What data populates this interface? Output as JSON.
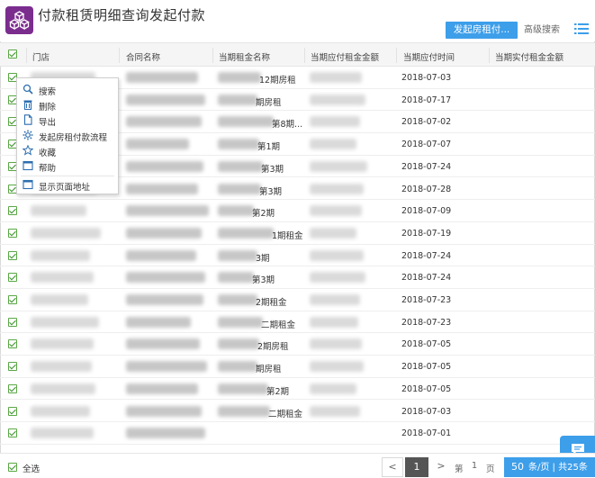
{
  "header": {
    "title": "付款租赁明细查询发起付款",
    "primary_button": "发起房租付...",
    "secondary_button": "高级搜索"
  },
  "table": {
    "columns": [
      "门店",
      "合同名称",
      "当期租金名称",
      "当期应付租金金额",
      "当期应付时间",
      "当期实付租金金额"
    ],
    "rows": [
      {
        "period": "12期房租",
        "date": "2018-07-03"
      },
      {
        "period": "期房租",
        "date": "2018-07-17"
      },
      {
        "period": "第8期...",
        "date": "2018-07-02"
      },
      {
        "period": "第1期",
        "date": "2018-07-07"
      },
      {
        "period": "第3期",
        "date": "2018-07-24"
      },
      {
        "period": "第3期",
        "date": "2018-07-28"
      },
      {
        "period": "第2期",
        "date": "2018-07-09"
      },
      {
        "period": "1期租金",
        "date": "2018-07-19"
      },
      {
        "period": "3期",
        "date": "2018-07-24"
      },
      {
        "period": "第3期",
        "date": "2018-07-24"
      },
      {
        "period": "2期租金",
        "date": "2018-07-23"
      },
      {
        "period": "二期租金",
        "date": "2018-07-23"
      },
      {
        "period": "2期房租",
        "date": "2018-07-05"
      },
      {
        "period": "期房租",
        "date": "2018-07-05"
      },
      {
        "period": "第2期",
        "date": "2018-07-05"
      },
      {
        "period": "二期租金",
        "date": "2018-07-03"
      },
      {
        "period": "",
        "date": "2018-07-01"
      }
    ]
  },
  "context_menu": {
    "items": [
      {
        "label": "搜索",
        "icon": "search-icon"
      },
      {
        "label": "删除",
        "icon": "trash-icon"
      },
      {
        "label": "导出",
        "icon": "document-icon"
      },
      {
        "label": "发起房租付款流程",
        "icon": "gear-icon"
      },
      {
        "label": "收藏",
        "icon": "star-icon"
      },
      {
        "label": "帮助",
        "icon": "help-window-icon"
      },
      {
        "label": "显示页面地址",
        "icon": "window-icon"
      }
    ]
  },
  "footer": {
    "select_all": "全选",
    "prev": "<",
    "current_page": "1",
    "next": ">",
    "page_prefix": "第",
    "page_input": "1",
    "page_suffix": "页",
    "page_size": "50",
    "page_size_unit": "条/页 | 共25条"
  },
  "colors": {
    "accent": "#3d9ee9",
    "app_icon": "#7b2d8e",
    "check": "#5aa845"
  }
}
